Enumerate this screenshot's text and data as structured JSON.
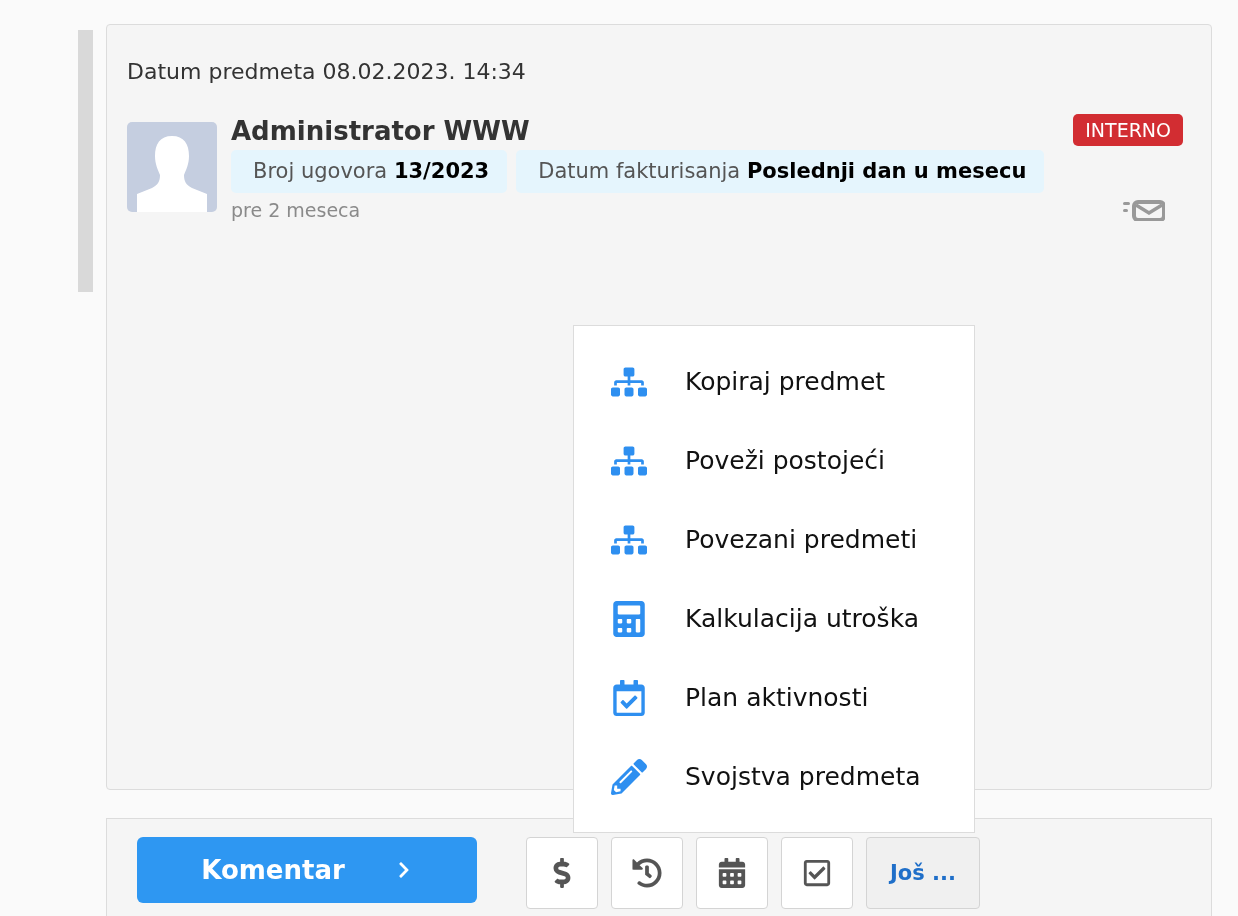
{
  "case_date": "Datum predmeta 08.02.2023. 14:34",
  "author": "Administrator WWW",
  "badge": "INTERNO",
  "tags": [
    {
      "label": "Broj ugovora",
      "value": "13/2023"
    },
    {
      "label": "Datum fakturisanja",
      "value": "Poslednji dan u mesecu"
    }
  ],
  "time_ago": "pre 2 meseca",
  "toolbar": {
    "comment_button": "Komentar",
    "more_button": {
      "label": "Još ...",
      "expanded": true
    }
  },
  "menu": [
    {
      "label": "Kopiraj predmet"
    },
    {
      "label": "Poveži postojeći"
    },
    {
      "label": "Povezani predmeti"
    },
    {
      "label": "Kalkulacija utroška"
    },
    {
      "label": "Plan aktivnosti"
    },
    {
      "label": "Svojstva predmeta"
    }
  ]
}
